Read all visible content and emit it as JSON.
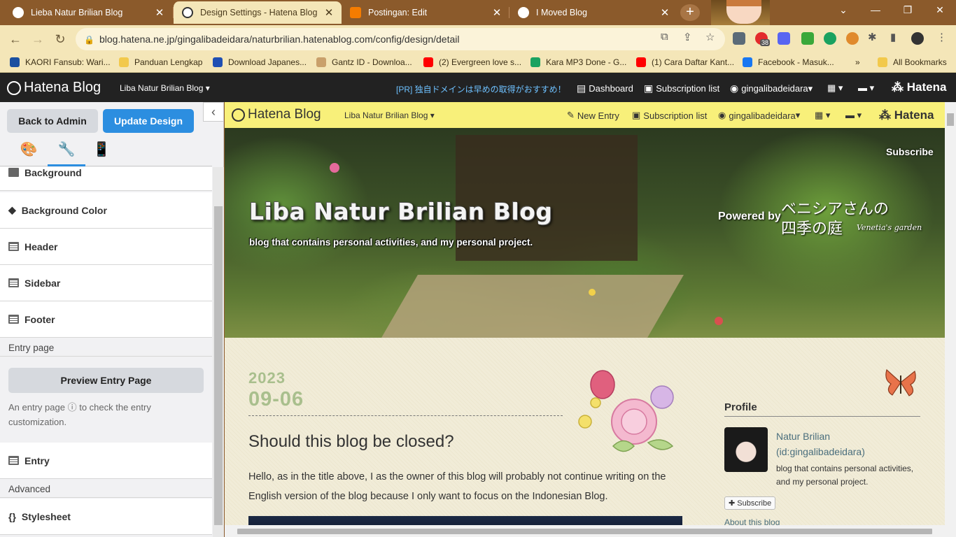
{
  "browser": {
    "tabs": [
      {
        "title": "Lieba Natur Brilian Blog",
        "favicon_color": "#222222"
      },
      {
        "title": "Design Settings - Hatena Blog",
        "favicon_color": "#333333"
      },
      {
        "title": "Postingan: Edit",
        "favicon_color": "#f57c00"
      },
      {
        "title": "I Moved Blog",
        "favicon_color": "#222222"
      }
    ],
    "url": "blog.hatena.ne.jp/gingalibadeidara/naturbrilian.hatenablog.com/config/design/detail",
    "extension_badge": "38",
    "bookmarks": [
      {
        "label": "KAORI Fansub: Wari...",
        "icon_color": "#1a4fa0"
      },
      {
        "label": "Panduan Lengkap",
        "icon_color": "#f2c94c"
      },
      {
        "label": "Download Japanes...",
        "icon_color": "#1f4fb3"
      },
      {
        "label": "Gantz ID - Downloa...",
        "icon_color": "#c9a06b"
      },
      {
        "label": "(2) Evergreen love s...",
        "icon_color": "#ff0000"
      },
      {
        "label": "Kara MP3 Done - G...",
        "icon_color": "#1aa260"
      },
      {
        "label": "(1) Cara Daftar Kant...",
        "icon_color": "#ff0000"
      },
      {
        "label": "Facebook - Masuk...",
        "icon_color": "#1877f2"
      }
    ],
    "all_bookmarks": "All Bookmarks"
  },
  "hatena_bar": {
    "logo": "Hatena Blog",
    "blog_select": "Liba Natur Brilian Blog",
    "pr_text": "[PR] 独自ドメインは早めの取得がおすすめ！",
    "dashboard": "Dashboard",
    "subscription": "Subscription list",
    "user": "gingalibadeidara",
    "hatena": "Hatena"
  },
  "panel": {
    "back_label": "Back to Admin",
    "update_label": "Update Design",
    "items": [
      {
        "label": "Background",
        "icon": "image-icon"
      },
      {
        "label": "Background Color",
        "icon": "paint-bucket-icon"
      },
      {
        "label": "Header",
        "icon": "layout-icon"
      },
      {
        "label": "Sidebar",
        "icon": "layout-icon"
      },
      {
        "label": "Footer",
        "icon": "layout-icon"
      }
    ],
    "entry_page_section": "Entry page",
    "preview_entry_label": "Preview Entry Page",
    "preview_note_before": "An entry page",
    "preview_note_after": "to check the entry customization.",
    "entry_label": "Entry",
    "advanced_section": "Advanced",
    "stylesheet_label": "Stylesheet"
  },
  "blog": {
    "bar": {
      "logo": "Hatena Blog",
      "blog_select": "Liba Natur Brilian Blog",
      "new_entry": "New Entry",
      "subscription": "Subscription list",
      "user": "gingalibadeidara",
      "hatena": "Hatena"
    },
    "subscribe": "Subscribe",
    "title": "Liba Natur Brilian Blog",
    "description": "blog that contains personal activities, and my personal project.",
    "powered_by": "Powered by",
    "garden_jp_line1": "ベニシアさんの",
    "garden_jp_line2": "四季の庭",
    "garden_en": "Venetia's garden",
    "date_year": "2023",
    "date_md": "09-06",
    "entry_title": "Should this blog be closed?",
    "entry_text": "Hello, as in the title above, I as the owner of this blog will probably not continue writing on the English version of the blog because I only want to focus on the Indonesian Blog.",
    "profile": {
      "heading": "Profile",
      "name": "Natur Brilian",
      "id": "(id:gingalibadeidara)",
      "description": "blog that contains personal activities, and my personal project.",
      "subscribe": "Subscribe",
      "about": "About this blog"
    }
  }
}
